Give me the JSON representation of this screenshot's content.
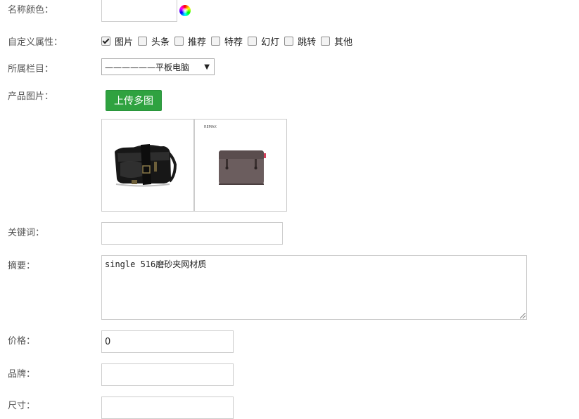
{
  "form": {
    "color_label": "名称颜色：",
    "attributes_label": "自定义属性：",
    "category_label": "所属栏目：",
    "images_label": "产品图片：",
    "keywords_label": "关键词：",
    "summary_label": "摘要：",
    "price_label": "价格：",
    "brand_label": "品牌：",
    "next_label": "尺寸："
  },
  "attributes": [
    {
      "label": "图片",
      "checked": true
    },
    {
      "label": "头条",
      "checked": false
    },
    {
      "label": "推荐",
      "checked": false
    },
    {
      "label": "特荐",
      "checked": false
    },
    {
      "label": "幻灯",
      "checked": false
    },
    {
      "label": "跳转",
      "checked": false
    },
    {
      "label": "其他",
      "checked": false
    }
  ],
  "category_select": {
    "value": "——————平板电脑"
  },
  "upload_button": "上传多图",
  "thumb_brand_text": "REMAX",
  "values": {
    "keywords": "",
    "summary": "single 516磨砂夹网材质",
    "price": "0",
    "brand": "",
    "next": ""
  },
  "colors": {
    "upload_button": "#2fa240",
    "border": "#cccccc"
  },
  "icons": {
    "color_picker": "color-wheel-icon",
    "select_caret": "caret-down-icon"
  }
}
